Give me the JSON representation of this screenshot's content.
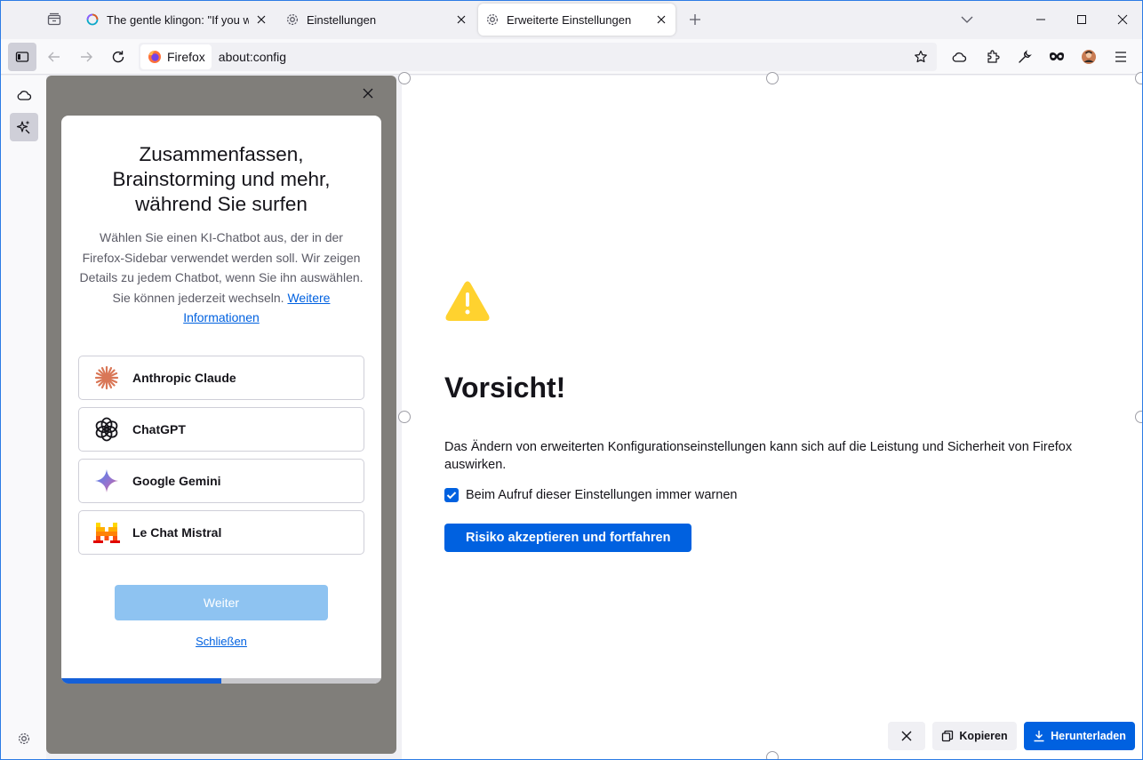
{
  "tabs": [
    {
      "title": "The gentle klingon: \"If you want",
      "active": false,
      "icon": "loading-spinner-icon"
    },
    {
      "title": "Einstellungen",
      "active": false,
      "icon": "gear-icon"
    },
    {
      "title": "Erweiterte Einstellungen",
      "active": true,
      "icon": "gear-icon"
    }
  ],
  "urlbar": {
    "identity_label": "Firefox",
    "url": "about:config"
  },
  "sidebar_panel": {
    "heading": "Zusammenfassen, Brainstorming und mehr, während Sie surfen",
    "description": "Wählen Sie einen KI-Chatbot aus, der in der Firefox-Sidebar verwendet werden soll. Wir zeigen Details zu jedem Chatbot, wenn Sie ihn auswählen. Sie können jederzeit wechseln.",
    "more_link": "Weitere Informationen",
    "providers": [
      {
        "name": "Anthropic Claude",
        "icon": "claude-icon"
      },
      {
        "name": "ChatGPT",
        "icon": "chatgpt-icon"
      },
      {
        "name": "Google Gemini",
        "icon": "gemini-icon"
      },
      {
        "name": "Le Chat Mistral",
        "icon": "mistral-icon"
      }
    ],
    "continue_label": "Weiter",
    "close_label": "Schließen",
    "progress": 0.5
  },
  "content": {
    "title": "Vorsicht!",
    "warning": "Das Ändern von erweiterten Konfigurationseinstellungen kann sich auf die Leistung und Sicherheit von Firefox auswirken.",
    "checkbox_label": "Beim Aufruf dieser Einstellungen immer warnen",
    "checkbox_checked": true,
    "accept_label": "Risiko akzeptieren und fortfahren"
  },
  "screenshot_toolbar": {
    "copy_label": "Kopieren",
    "download_label": "Herunterladen"
  },
  "colors": {
    "accent": "#0061e0",
    "warning": "#ffd22f"
  }
}
